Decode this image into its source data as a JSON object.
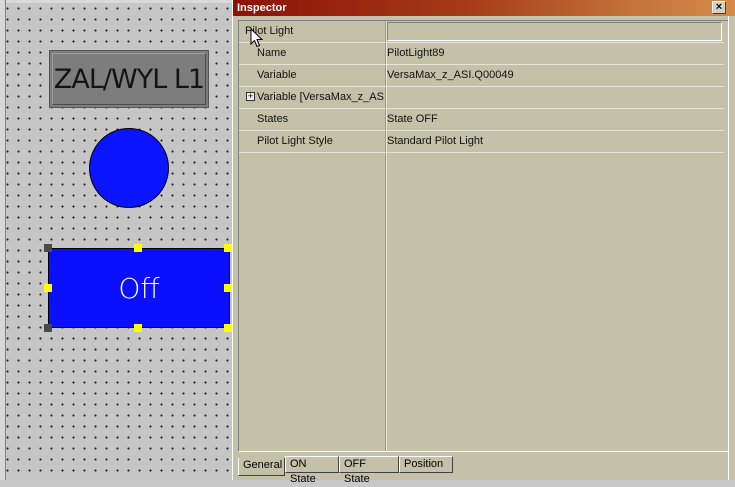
{
  "canvas": {
    "label_text": "ZAL/WYL L1",
    "pilot_light_text": "Off"
  },
  "inspector": {
    "title": "Inspector",
    "close_glyph": "×",
    "header": {
      "name": "Pilot Light",
      "value": ""
    },
    "properties": [
      {
        "name": "Name",
        "value": "PilotLight89",
        "expandable": false
      },
      {
        "name": "Variable",
        "value": "VersaMax_z_ASI.Q00049",
        "expandable": false
      },
      {
        "name": "Variable [VersaMax_z_AS",
        "value": "",
        "expandable": true,
        "expand_glyph": "+"
      },
      {
        "name": "States",
        "value": "State OFF",
        "expandable": false
      },
      {
        "name": "Pilot Light Style",
        "value": "Standard Pilot Light",
        "expandable": false
      }
    ],
    "tabs": [
      {
        "label": "General",
        "active": true
      },
      {
        "label": "ON State",
        "active": false
      },
      {
        "label": "OFF State",
        "active": false
      },
      {
        "label": "Position",
        "active": false
      }
    ]
  },
  "colors": {
    "pilot_blue": "#0a10ff",
    "handle_yellow": "#ffff00",
    "title_gradient_start": "#8c1207",
    "panel_bg": "#c4c1a9"
  }
}
